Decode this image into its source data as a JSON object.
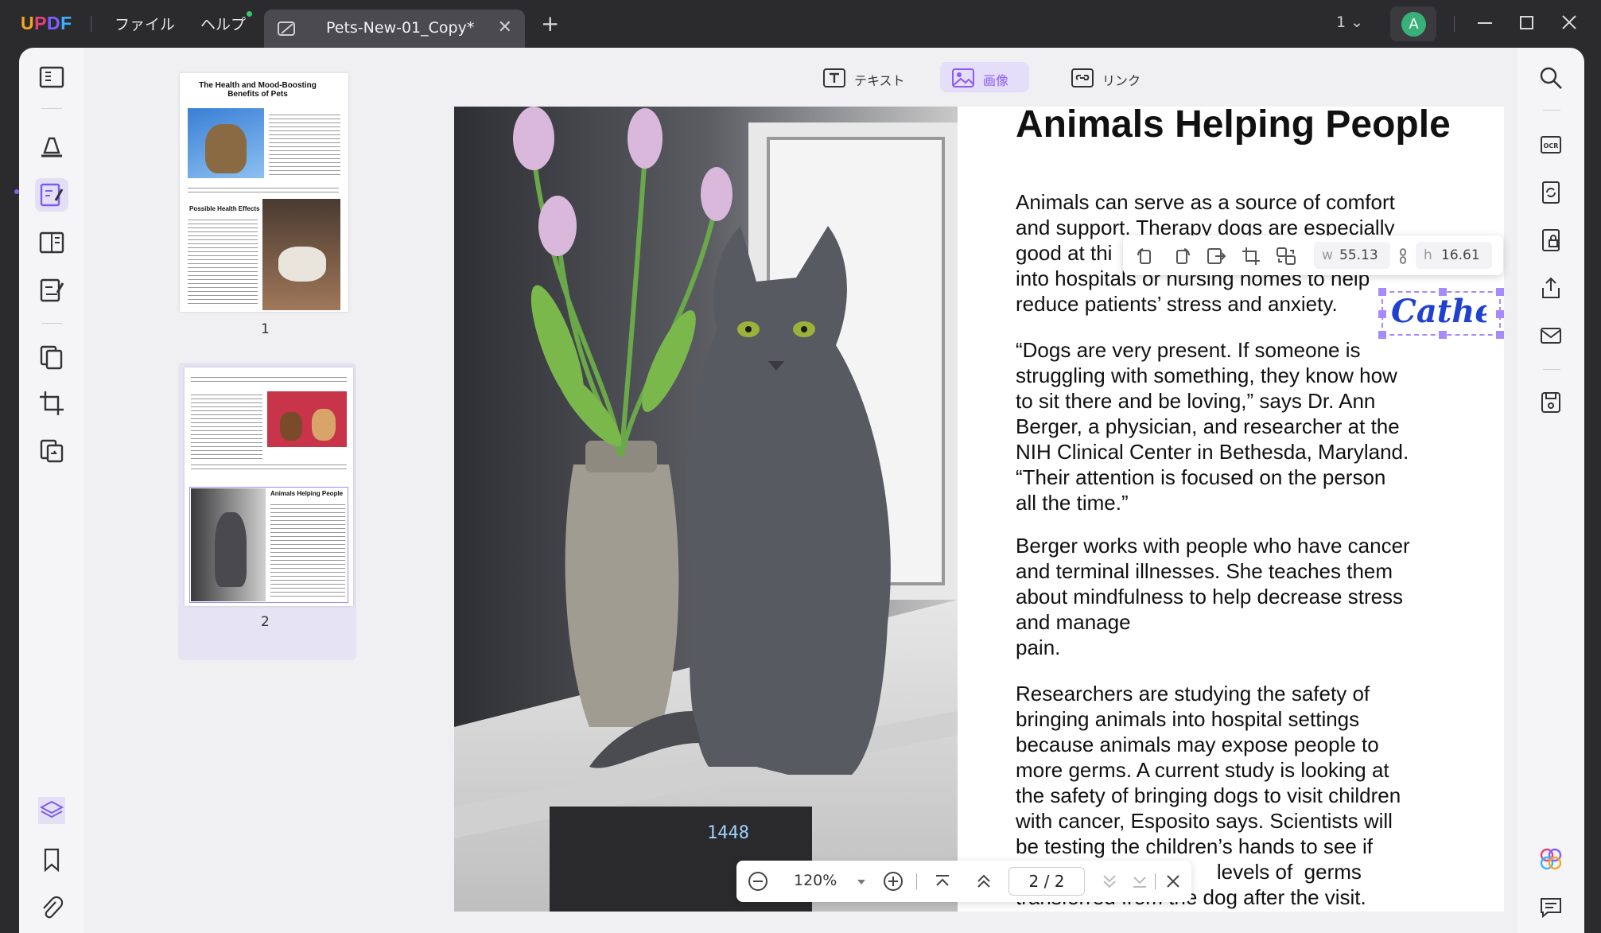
{
  "app": {
    "logo": "UPDF",
    "menus": [
      "ファイル",
      "ヘルプ"
    ],
    "tab_title": "Pets-New-01_Copy*",
    "page_selector": "1",
    "avatar_letter": "A",
    "accent": "#8b5cf6"
  },
  "edit_toolbar": {
    "text_label": "テキスト",
    "image_label": "画像",
    "link_label": "リンク"
  },
  "image_toolbar": {
    "width_label": "w",
    "width_value": "55.13",
    "height_label": "h",
    "height_value": "16.61"
  },
  "thumbnails": [
    {
      "number": "1",
      "title": "The Health and Mood-Boosting Benefits of Pets",
      "section": "Possible Health Effects"
    },
    {
      "number": "2",
      "section": "Animals Helping People"
    }
  ],
  "page": {
    "heading": "Animals Helping People",
    "signature_text": "Cathe",
    "paragraphs": [
      [
        "Animals can serve as a source of comfort",
        "and support. Therapy dogs are especially",
        "good at thi",
        "into hospitals or nursing homes to help",
        "reduce patients’ stress and anxiety."
      ],
      [
        "“Dogs are very present. If someone is",
        "struggling with something, they know how",
        "to sit there and be loving,”  says  Dr.  Ann",
        "Berger,  a  physician, and researcher at the",
        "NIH Clinical Center in Bethesda, Maryland.",
        "“Their  attention  is  focused  on  the person",
        "all the time.”"
      ],
      [
        "Berger works with people who have cancer",
        "and terminal illnesses.  She  teaches  them",
        "about mindfulness to help decrease stress",
        "and manage",
        "pain."
      ],
      [
        "Researchers are studying the safety of",
        "bringing animals into hospital settings",
        "because animals may expose people to",
        "more germs.  A  current study is looking at",
        "the safety of bringing dogs to visit children",
        "with cancer,  Esposito says. Scientists will",
        "be testing the children’s hands to see if",
        "                                   levels of  germs",
        "transferred from the dog after the visit."
      ]
    ]
  },
  "zoom": {
    "value": "120%",
    "page_indicator": "2 / 2"
  }
}
